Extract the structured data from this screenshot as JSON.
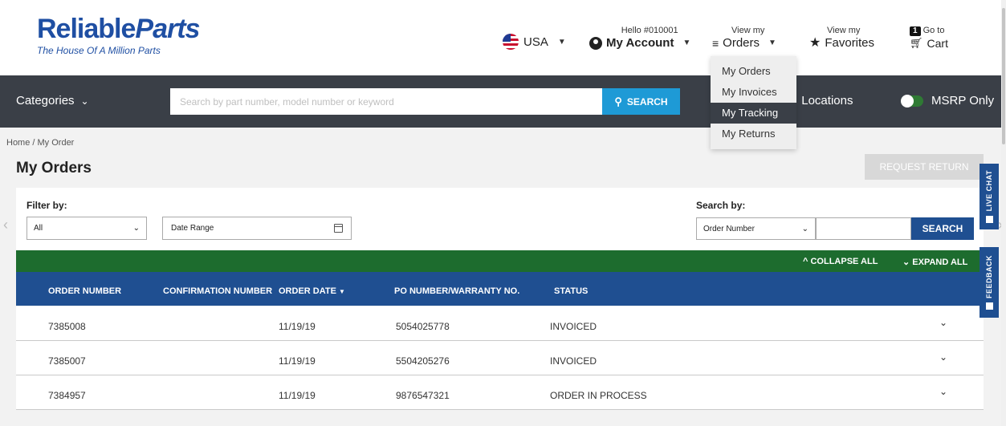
{
  "logo": {
    "name_part1": "Reliable",
    "name_part2": "Parts",
    "tagline": "The House Of A Million Parts"
  },
  "header": {
    "country": "USA",
    "account_greeting": "Hello #010001",
    "account_label": "My Account",
    "orders_top": "View my",
    "orders_label": "Orders",
    "favorites_top": "View my",
    "favorites_label": "Favorites",
    "cart_count": "1",
    "cart_top": "Go to",
    "cart_label": "Cart"
  },
  "nav": {
    "categories": "Categories",
    "search_placeholder": "Search by part number, model number or keyword",
    "search_button": "SEARCH",
    "locations": "Locations",
    "msrp": "MSRP Only"
  },
  "orders_dropdown": [
    {
      "label": "My Orders",
      "active": false
    },
    {
      "label": "My Invoices",
      "active": false
    },
    {
      "label": "My Tracking",
      "active": true
    },
    {
      "label": "My Returns",
      "active": false
    }
  ],
  "breadcrumb": "Home / My Order",
  "page_title": "My Orders",
  "request_return": "REQUEST RETURN",
  "filter": {
    "label": "Filter by:",
    "status_value": "All",
    "date_placeholder": "Date Range",
    "search_label": "Search by:",
    "search_type": "Order Number",
    "search_button": "SEARCH"
  },
  "collapse_all": "COLLAPSE ALL",
  "expand_all": "EXPAND ALL",
  "table": {
    "headers": [
      "ORDER NUMBER",
      "CONFIRMATION NUMBER",
      "ORDER DATE",
      "PO NUMBER/WARRANTY NO.",
      "STATUS"
    ],
    "rows": [
      {
        "order": "7385008",
        "confirmation": "",
        "date": "11/19/19",
        "po": "5054025778",
        "status": "INVOICED"
      },
      {
        "order": "7385007",
        "confirmation": "",
        "date": "11/19/19",
        "po": "5504205276",
        "status": "INVOICED"
      },
      {
        "order": "7384957",
        "confirmation": "",
        "date": "11/19/19",
        "po": "9876547321",
        "status": "ORDER IN PROCESS"
      }
    ]
  },
  "side_tabs": {
    "live_chat": "LIVE CHAT",
    "feedback": "FEEDBACK"
  },
  "colors": {
    "brand_blue": "#1f4fa3",
    "nav_dark": "#3a3f47",
    "search_blue": "#1e9ad6",
    "table_blue": "#1f4f91",
    "green_bar": "#1d6c2e"
  }
}
